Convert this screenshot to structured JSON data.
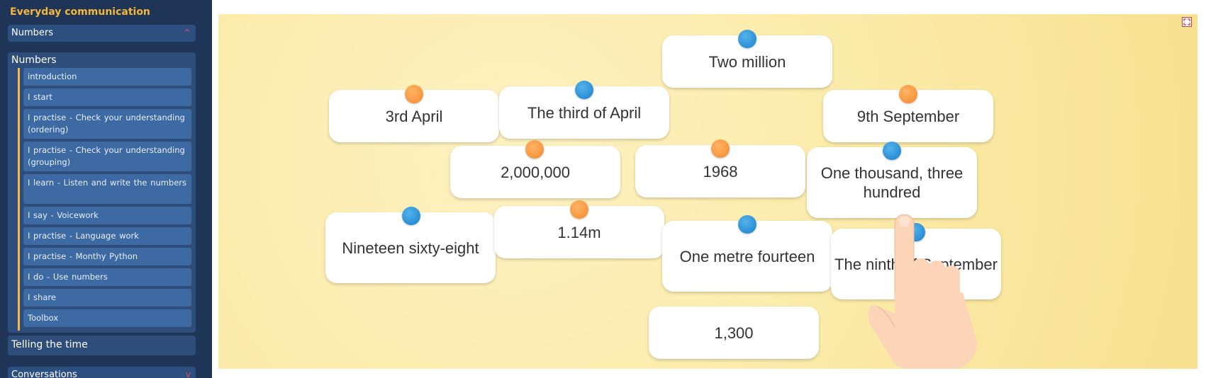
{
  "sidebar": {
    "course_title": "Everyday communication",
    "section_numbers": "Numbers",
    "section_numbers_chevron": "^",
    "group_label": "Numbers",
    "items": [
      {
        "label": "introduction"
      },
      {
        "label": "I start"
      },
      {
        "label": "I practise - Check your understanding (ordering)"
      },
      {
        "label": "I practise - Check your understanding (grouping)"
      },
      {
        "label": "I learn - Listen and write the numbers"
      },
      {
        "label": "I say - Voicework"
      },
      {
        "label": "I practise - Language work"
      },
      {
        "label": "I practise - Monthy Python"
      },
      {
        "label": "I do - Use numbers"
      },
      {
        "label": "I share"
      },
      {
        "label": "Toolbox"
      }
    ],
    "telling_time": "Telling the time",
    "conversations": "Conversations",
    "conversations_chevron": "v"
  },
  "board": {
    "colors": {
      "pin_blue": "#2b8fd6",
      "pin_orange": "#f9963e",
      "accent": "#f5b73a"
    },
    "cards": [
      {
        "text": "Two million",
        "pin": "blue"
      },
      {
        "text": "3rd April",
        "pin": "orange"
      },
      {
        "text": "The third of April",
        "pin": "blue"
      },
      {
        "text": "9th September",
        "pin": "orange"
      },
      {
        "text": "2,000,000",
        "pin": "orange"
      },
      {
        "text": "1968",
        "pin": "orange"
      },
      {
        "text": "One thousand, three hundred",
        "pin": "blue"
      },
      {
        "text": "Nineteen sixty-eight",
        "pin": "blue"
      },
      {
        "text": "1.14m",
        "pin": "orange"
      },
      {
        "text": "One metre fourteen",
        "pin": "blue"
      },
      {
        "text": "The ninth of September",
        "pin": "blue"
      },
      {
        "text": "1,300",
        "pin": "none"
      }
    ],
    "fullscreen_icon": "expand-icon",
    "hand_icon": "pointing-hand-icon"
  }
}
